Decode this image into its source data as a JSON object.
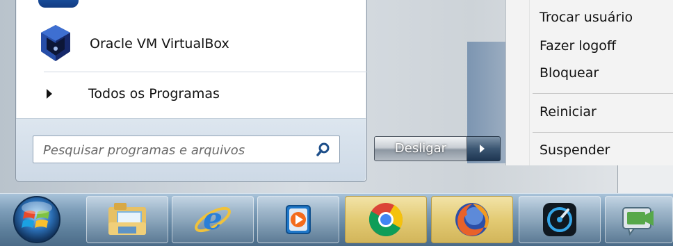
{
  "start_menu": {
    "programs": [
      {
        "label": "Oracle VM VirtualBox",
        "icon": "virtualbox-icon"
      }
    ],
    "all_programs_label": "Todos os Programas",
    "search": {
      "placeholder": "Pesquisar programas e arquivos",
      "value": ""
    },
    "shutdown": {
      "label": "Desligar"
    },
    "power_menu": {
      "items": [
        "Trocar usuário",
        "Fazer logoff",
        "Bloquear",
        "Reiniciar",
        "Suspender"
      ]
    }
  },
  "taskbar": {
    "items": [
      {
        "icon": "windows-start-orb"
      },
      {
        "icon": "file-explorer-icon"
      },
      {
        "icon": "internet-explorer-icon"
      },
      {
        "icon": "media-player-icon"
      },
      {
        "icon": "chrome-icon"
      },
      {
        "icon": "firefox-icon"
      },
      {
        "icon": "dark-orb-app-icon"
      },
      {
        "icon": "video-chat-icon"
      }
    ]
  },
  "colors": {
    "taskbar": "#5d7f9b",
    "active_taskbar_item": "#e3cb74",
    "shutdown_arrow": "#3b5672"
  }
}
